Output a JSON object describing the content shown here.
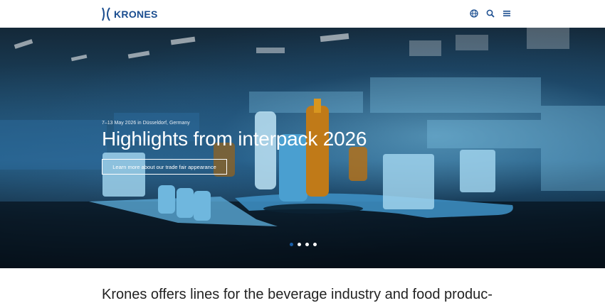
{
  "header": {
    "logo_text": "KRONES",
    "icons": [
      "globe-icon",
      "search-icon",
      "menu-icon"
    ]
  },
  "hero": {
    "eyebrow": "7–13 May 2026 in Düsseldorf, Germany",
    "title": "Highlights from interpack 2026",
    "cta_label": "Learn more about our trade fair appearance",
    "slides_count": 4,
    "active_slide": 1
  },
  "intro": {
    "heading": "Krones offers lines for the beverage industry and food produc-"
  },
  "colors": {
    "brand": "#1a4d8f",
    "active_dot": "#1a5fa8"
  }
}
